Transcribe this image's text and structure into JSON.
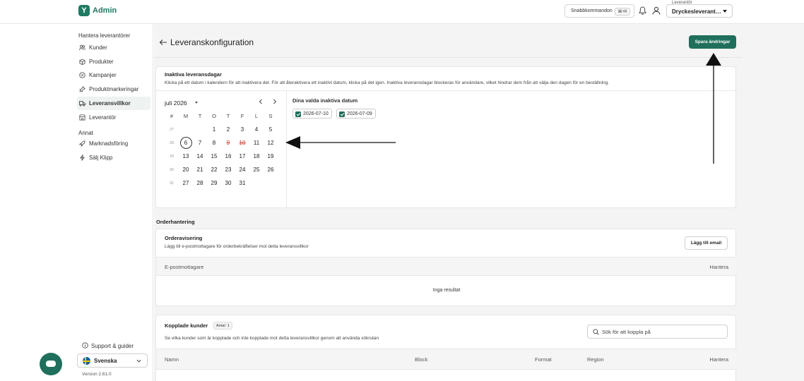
{
  "app": {
    "brand": "Admin",
    "logo_glyph": "Y"
  },
  "topbar": {
    "quick_commands": "Snabbkommandon",
    "shortcut": "⌘+K",
    "supplier_label": "Leverantör",
    "supplier_value": "Dryckesleverant…"
  },
  "sidebar": {
    "section1": "Hantera leverantörer",
    "items1": [
      {
        "label": "Kunder",
        "icon": "users-icon"
      },
      {
        "label": "Produkter",
        "icon": "box-icon"
      },
      {
        "label": "Kampanjer",
        "icon": "percent-icon"
      },
      {
        "label": "Produktmarkeringar",
        "icon": "pin-icon"
      },
      {
        "label": "Leveransvillkor",
        "icon": "truck-icon",
        "active": true
      },
      {
        "label": "Leverantör",
        "icon": "store-icon"
      }
    ],
    "section2": "Annat",
    "items2": [
      {
        "label": "Marknadsföring",
        "icon": "rocket-icon"
      },
      {
        "label": "Sälj Klipp",
        "icon": "bolt-icon"
      }
    ],
    "support": "Support & guider",
    "language": "Svenska",
    "version": "Version 2.61.0"
  },
  "page": {
    "title": "Leveranskonfiguration",
    "save_label": "Spara ändringar"
  },
  "inactive_days": {
    "title": "Inaktiva leveransdagar",
    "desc": "Klicka på ett datum i kalendern för att inaktivera det. För att återaktivera ett inaktivt datum, klicka på det igen. Inaktiva leveransdagar blockeras för användare, vilket hindrar dem från att välja den dagen för en beställning.",
    "month": "juli 2026",
    "week_head": "#",
    "day_heads": [
      "M",
      "T",
      "O",
      "T",
      "F",
      "L",
      "S"
    ],
    "weeks": [
      {
        "wk": "27",
        "days": [
          "",
          "",
          "1",
          "2",
          "3",
          "4",
          "5"
        ]
      },
      {
        "wk": "28",
        "days": [
          "6",
          "7",
          "8",
          "9",
          "10",
          "11",
          "12"
        ]
      },
      {
        "wk": "29",
        "days": [
          "13",
          "14",
          "15",
          "16",
          "17",
          "18",
          "19"
        ]
      },
      {
        "wk": "30",
        "days": [
          "20",
          "21",
          "22",
          "23",
          "24",
          "25",
          "26"
        ]
      },
      {
        "wk": "31",
        "days": [
          "27",
          "28",
          "29",
          "30",
          "31",
          "",
          ""
        ]
      }
    ],
    "today": "6",
    "blocked": [
      "9",
      "10"
    ],
    "selected_title": "Dina valda inaktiva datum",
    "selected_dates": [
      "2026-07-10",
      "2026-07-09"
    ]
  },
  "order": {
    "section": "Orderhantering",
    "title": "Orderavisering",
    "desc": "Lägg till e-postmottagare för orderbekräftelser mot detta leveransvillkor",
    "add_email": "Lägg till email",
    "col_email": "E-postmottagare",
    "col_manage": "Hantera",
    "empty": "Inga resultat"
  },
  "linked": {
    "title": "Kopplade kunder",
    "count_badge": "Antal: 1",
    "desc": "Se vilka kunder som är kopplade och inte kopplade mot detta leveransvillkor genom att använda sökrutan",
    "search_placeholder": "Sök för att koppla på",
    "cols": [
      "Namn",
      "Block",
      "Format",
      "Region",
      "Hantera"
    ]
  },
  "colors": {
    "accent": "#1f6f5c",
    "blocked": "#d0362a"
  }
}
